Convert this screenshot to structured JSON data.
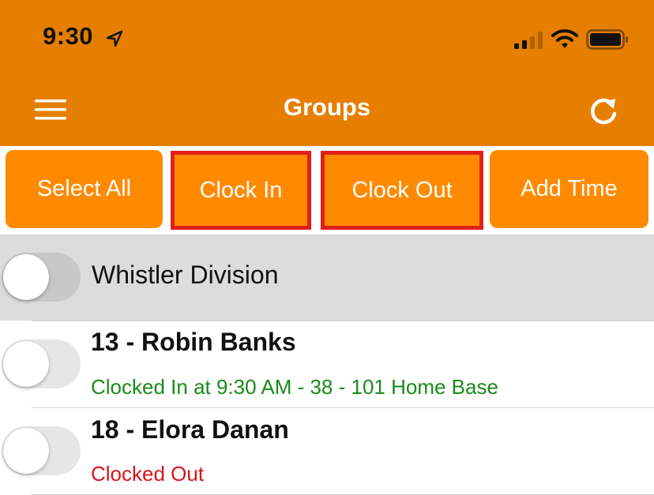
{
  "status_bar": {
    "time": "9:30"
  },
  "header": {
    "title": "Groups",
    "menu_icon": "hamburger-menu-icon",
    "refresh_icon": "refresh-icon",
    "background_color": "#e67e00"
  },
  "actions": {
    "select_all": "Select All",
    "clock_in": "Clock In",
    "clock_out": "Clock Out",
    "add_time": "Add Time",
    "button_color": "#ff8a00",
    "highlight_color": "#e0201b"
  },
  "group": {
    "name": "Whistler Division",
    "toggle_on": false
  },
  "employees": [
    {
      "name": "13 - Robin Banks",
      "status": "Clocked In at 9:30 AM - 38 - 101 Home Base",
      "status_color": "#1a8a1a",
      "toggle_on": false
    },
    {
      "name": "18 - Elora Danan",
      "status": "Clocked Out",
      "status_color": "#d9141b",
      "toggle_on": false
    }
  ]
}
